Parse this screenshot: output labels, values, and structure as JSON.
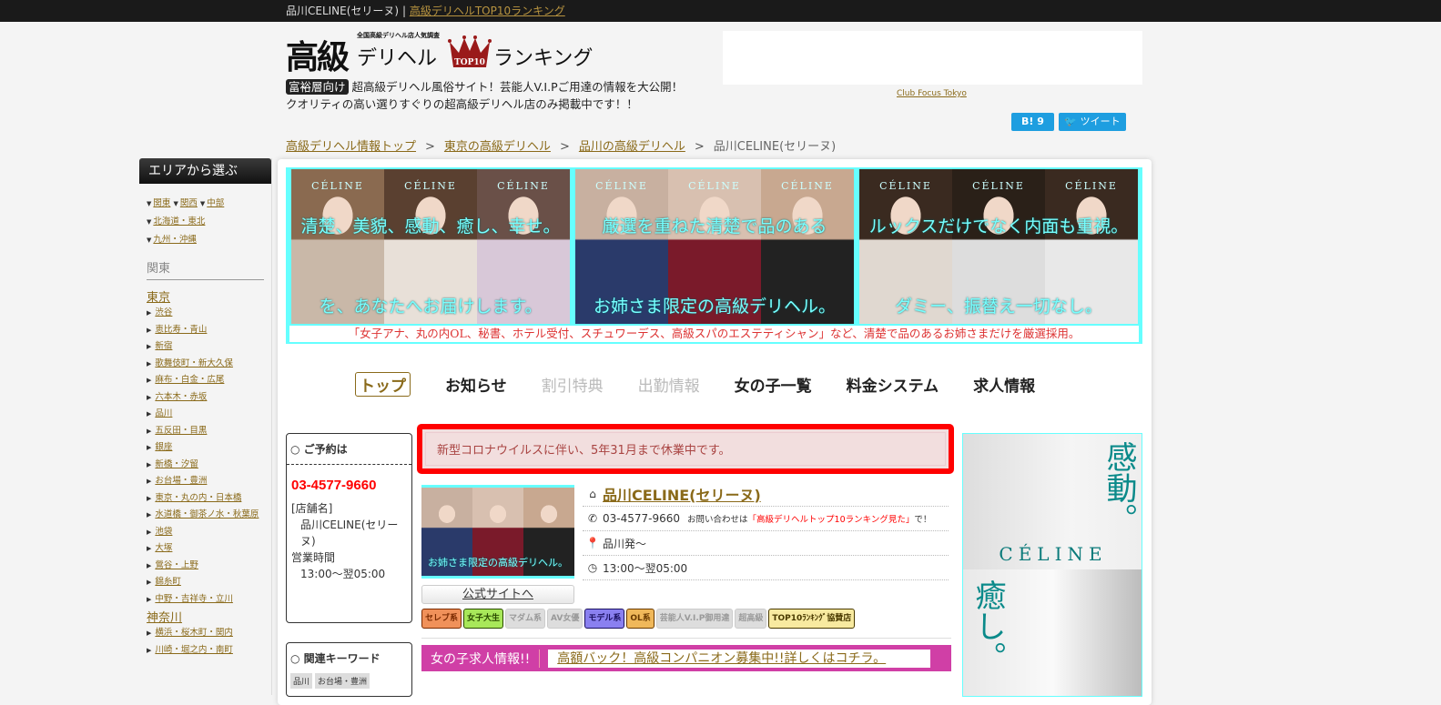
{
  "topbar": {
    "site": "品川CELINE(セリーヌ)",
    "sep": "|",
    "link": "高級デリヘルTOP10ランキング"
  },
  "logo": {
    "kanji": "高級",
    "kana1": "デリヘル",
    "kana2": "ランキング",
    "sub": "全国高級デリヘル店人気調査",
    "crown": "TOP10"
  },
  "tagline": {
    "badge": "富裕層向け",
    "line1": "超高級デリヘル風俗サイト！芸能人V.I.Pご用達の情報を大公開！",
    "line2": "クオリティの高い選りすぐりの超高級デリヘル店のみ掲載中です！！"
  },
  "ad": {
    "link": "Club Focus Tokyo"
  },
  "social": {
    "hatena": "B! 9",
    "tweet": "ツイート"
  },
  "breadcrumb": [
    "高級デリヘル情報トップ",
    "東京の高級デリヘル",
    "品川の高級デリヘル",
    "品川CELINE(セリーヌ)"
  ],
  "breadcrumb_sep": ">",
  "sidebar": {
    "title": "エリアから選ぶ",
    "regions": [
      "関東",
      "関西",
      "中部",
      "北海道・東北",
      "九州・沖縄"
    ],
    "category": "関東",
    "prefs": [
      {
        "name": "東京",
        "areas": [
          "渋谷",
          "恵比寿・青山",
          "新宿",
          "歌舞伎町・新大久保",
          "麻布・白金・広尾",
          "六本木・赤坂",
          "品川",
          "五反田・目黒",
          "銀座",
          "新橋・汐留",
          "お台場・豊洲",
          "東京・丸の内・日本橋",
          "水道橋・御茶ノ水・秋葉原",
          "池袋",
          "大塚",
          "鶯谷・上野",
          "錦糸町",
          "中野・吉祥寺・立川"
        ]
      },
      {
        "name": "神奈川",
        "areas": [
          "横浜・桜木町・関内",
          "川崎・堀之内・南町"
        ]
      }
    ]
  },
  "banner": {
    "brand": "CÉLINE",
    "panels": [
      {
        "top": "清楚、美貌、感動、癒し、幸せ。",
        "bottom": "を、あなたへお届けします。"
      },
      {
        "top": "厳選を重ねた清楚で品のある",
        "bottom": "お姉さま限定の高級デリヘル。"
      },
      {
        "top": "ルックスだけでなく内面も重視。",
        "bottom": "ダミー、振替え一切なし。"
      }
    ],
    "strip": "「女子アナ、丸の内OL、秘書、ホテル受付、スチュワーデス、高級スパのエステティシャン」など、清楚で品のあるお姉さまだけを厳選採用。"
  },
  "nav": [
    {
      "label": "トップ",
      "state": "active"
    },
    {
      "label": "お知らせ",
      "state": "on"
    },
    {
      "label": "割引特典",
      "state": "off"
    },
    {
      "label": "出勤情報",
      "state": "off"
    },
    {
      "label": "女の子一覧",
      "state": "on"
    },
    {
      "label": "料金システム",
      "state": "on"
    },
    {
      "label": "求人情報",
      "state": "on"
    }
  ],
  "reservation": {
    "title": "○ ご予約は",
    "tel": "03-4577-9660",
    "shop_label": "[店舗名]",
    "shop": "品川CELINE(セリーヌ)",
    "hours_label": "営業時間",
    "hours": "13:00～翌05:00"
  },
  "keywords": {
    "title": "○ 関連キーワード",
    "tags": [
      "品川",
      "お台場・豊洲"
    ]
  },
  "notice": "新型コロナウイルスに伴い、5年31月まで休業中です。",
  "shop": {
    "name": "品川CELINE(セリーヌ)",
    "tel": "03-4577-9660",
    "inquiry_pre": "お問い合わせは",
    "inquiry_red": "「高級デリヘルトップ10ランキング見た」",
    "inquiry_post": "で！",
    "area": "品川発～",
    "hours": "13:00～翌05:00",
    "site_button": "公式サイトへ",
    "thumb_text": "お姉さま限定の高級デリヘル。"
  },
  "tags": [
    {
      "label": "セレブ系",
      "bg": "#f0915a",
      "fg": "#7a2a00"
    },
    {
      "label": "女子大生",
      "bg": "#a8e85a",
      "fg": "#2a4a00"
    },
    {
      "label": "マダム系",
      "bg": "#ddd",
      "fg": "#999"
    },
    {
      "label": "AV女優",
      "bg": "#ddd",
      "fg": "#999"
    },
    {
      "label": "モデル系",
      "bg": "#8a80f0",
      "fg": "#1a1060"
    },
    {
      "label": "OL系",
      "bg": "#f0b85a",
      "fg": "#6a3a00"
    },
    {
      "label": "芸能人V.I.P御用達",
      "bg": "#ddd",
      "fg": "#999"
    },
    {
      "label": "超高級",
      "bg": "#ddd",
      "fg": "#999"
    },
    {
      "label": "TOP10ﾗﾝｷﾝｸﾞ協賛店",
      "bg": "#f8eaa0",
      "fg": "#4a3a00"
    }
  ],
  "recruit": {
    "label": "女の子求人情報!!",
    "link": "高額バック！高級コンパニオン募集中!!詳しくはコチラ。"
  },
  "side_ad": {
    "text1": "感動。",
    "text2": "癒し。",
    "brand": "CÉLINE"
  },
  "colors": {
    "accent": "#8a6a1a",
    "alert": "#ff0000",
    "recruit": "#d03fa6",
    "banner": "#66ffff"
  }
}
